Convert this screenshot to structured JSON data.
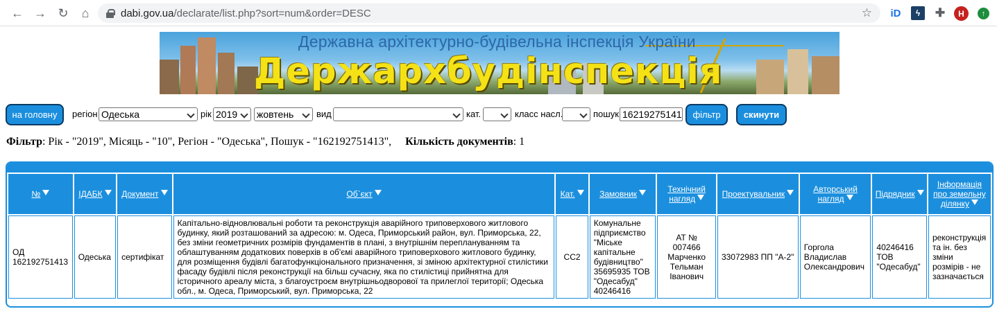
{
  "browser": {
    "url_host": "dabi.gov.ua",
    "url_path": "/declarate/list.php?sort=num&order=DESC",
    "avatar_letter": "H"
  },
  "banner": {
    "subtitle": "Державна архітектурно-будівельна інспекція України",
    "title": "Держархбудінспекція України"
  },
  "toolbar": {
    "home_button": "на головну",
    "region_label": "регіон",
    "region_value": "Одеська",
    "year_label": "рік",
    "year_value": "2019",
    "month_value": "жовтень",
    "type_label": "вид",
    "type_value": "",
    "cat_label": "кат.",
    "cat_value": "",
    "class_label": "класс насл.",
    "class_value": "",
    "search_label": "пошук",
    "search_value": "16219275141",
    "filter_button": "фільтр",
    "reset_button": "скинути"
  },
  "filter_summary": {
    "label": "Фільтр",
    "text": ": Рік - \"2019\", Місяць - \"10\", Регіон - \"Одеська\", Пошук - \"162192751413\",",
    "count_label": "Кількість документів",
    "count_value": ": 1"
  },
  "table": {
    "headers": {
      "num": "№",
      "idabk": "ІДАБК",
      "document": "Документ",
      "object": "Об`єкт",
      "cat": "Кат.",
      "customer": "Замовник",
      "tech_supervision": "Технічний нагляд",
      "designer": "Проектувальник",
      "author_supervision": "Авторський нагляд",
      "contractor": "Підрядник",
      "land_info": "Інформація про земельну ділянку"
    },
    "row": {
      "num": "ОД 162192751413",
      "idabk": "Одеська",
      "document": "сертифікат",
      "object": "Капітально-відновлювальні роботи та реконструкція аварійного триповерхового житлового будинку, який розташований за адресою: м. Одеса, Приморський район, вул. Приморська, 22, без зміни геометричних розмірів фундаментів в плані, з внутрішнім переплануванням та облаштуванням додаткових поверхів в об'ємі аварійного триповерхового житлового будинку, для розміщення будівлі багатофункціонального призначення, зі зміною архітектурної стилістики фасаду будівлі після реконструкції на більш сучасну, яка по стилістиці прийнятна для історичного ареалу міста, з благоустроєм внутрішньодворової та прилеглої території; Одеська обл., м. Одеса, Приморський, вул. Приморська, 22",
      "cat": "СС2",
      "customer": "Комунальне підприємство \"Міське капітальне будівництво\" 35695935 ТОВ \"Одесабуд\" 40246416",
      "tech_supervision": "АТ № 007466 Марченко Тельман Іванович",
      "designer": "33072983 ПП \"А-2\"",
      "author_supervision": "Горгола Владислав Олександрович",
      "contractor": "40246416 ТОВ \"Одесабуд\"",
      "land_info": "реконструкція та ін. без зміни розмірів - не зазначається"
    }
  }
}
